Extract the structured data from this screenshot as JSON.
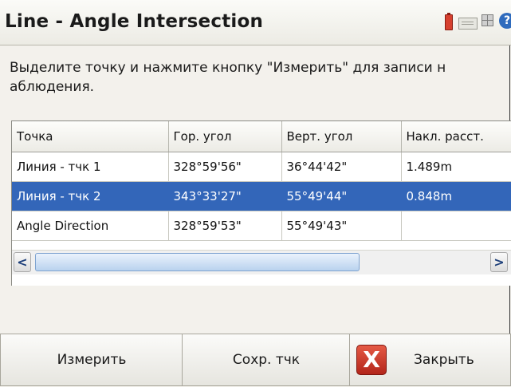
{
  "window": {
    "title": "Line - Angle Intersection",
    "icons": [
      "battery-icon",
      "keyboard-icon",
      "grid-icon",
      "help-icon"
    ],
    "help_glyph": "?"
  },
  "instruction": "Выделите точку и нажмите кнопку \"Измерить\" для записи н\nаблюдения.",
  "table": {
    "columns": [
      "Точка",
      "Гор. угол",
      "Верт. угол",
      "Накл. расст."
    ],
    "rows": [
      [
        "Линия - тчк 1",
        "328°59'56\"",
        "36°44'42\"",
        "1.489m"
      ],
      [
        "Линия - тчк 2",
        "343°33'27\"",
        "55°49'44\"",
        "0.848m"
      ],
      [
        "Angle Direction",
        "328°59'53\"",
        "55°49'43\"",
        ""
      ]
    ],
    "selected_row": 1
  },
  "scrollbar": {
    "left_arrow": "<",
    "right_arrow": ">",
    "position_fraction": 0.0
  },
  "buttons": {
    "measure": "Измерить",
    "save_point": "Сохр. тчк",
    "close": "Закрыть",
    "close_icon_glyph": "X"
  },
  "colors": {
    "selection": "#3366b9",
    "close_icon": "#c8321f"
  }
}
